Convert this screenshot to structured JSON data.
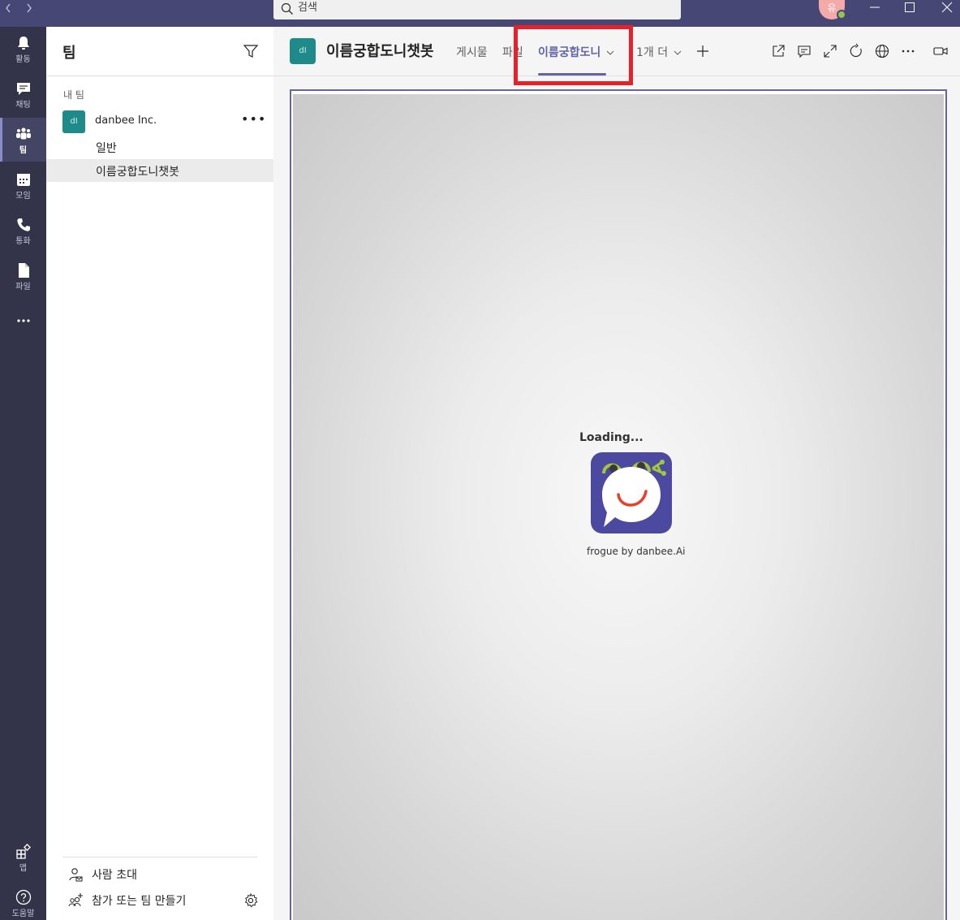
{
  "titlebar": {
    "search_placeholder": "검색",
    "avatar_initial": "유"
  },
  "rail": {
    "items": [
      {
        "label": "활동",
        "icon": "bell-icon"
      },
      {
        "label": "채팅",
        "icon": "chat-icon"
      },
      {
        "label": "팀",
        "icon": "teams-icon",
        "active": true
      },
      {
        "label": "모임",
        "icon": "calendar-icon"
      },
      {
        "label": "통화",
        "icon": "phone-icon"
      },
      {
        "label": "파일",
        "icon": "file-icon"
      },
      {
        "label": "",
        "icon": "more-icon"
      }
    ],
    "bottom": [
      {
        "label": "앱",
        "icon": "apps-icon"
      },
      {
        "label": "도움말",
        "icon": "help-icon"
      }
    ]
  },
  "panel": {
    "title": "팀",
    "section_label": "내 팀",
    "team": {
      "avatar_text": "dI",
      "name": "danbee Inc.",
      "more": "•••"
    },
    "channels": [
      {
        "label": "일반"
      },
      {
        "label": "이름궁합도니챗봇",
        "selected": true
      }
    ],
    "invite_label": "사람 초대",
    "join_create_label": "참가 또는 팀 만들기"
  },
  "header": {
    "avatar_text": "dI",
    "title": "이름궁합도니챗봇",
    "tabs": [
      {
        "label": "게시물"
      },
      {
        "label": "파일"
      },
      {
        "label": "이름궁합도니",
        "active": true
      },
      {
        "label": "1개 더"
      }
    ]
  },
  "content": {
    "loading_text": "Loading...",
    "caption": "frogue by danbee.Ai"
  },
  "colors": {
    "titlebar": "#464775",
    "rail": "#33344a",
    "accent": "#6264a7",
    "highlight": "#e8202a",
    "team_avatar": "#1f8a8a",
    "logo_bg": "#4b4aa0",
    "logo_frog": "#a4c63a",
    "smile": "#e8402a"
  }
}
